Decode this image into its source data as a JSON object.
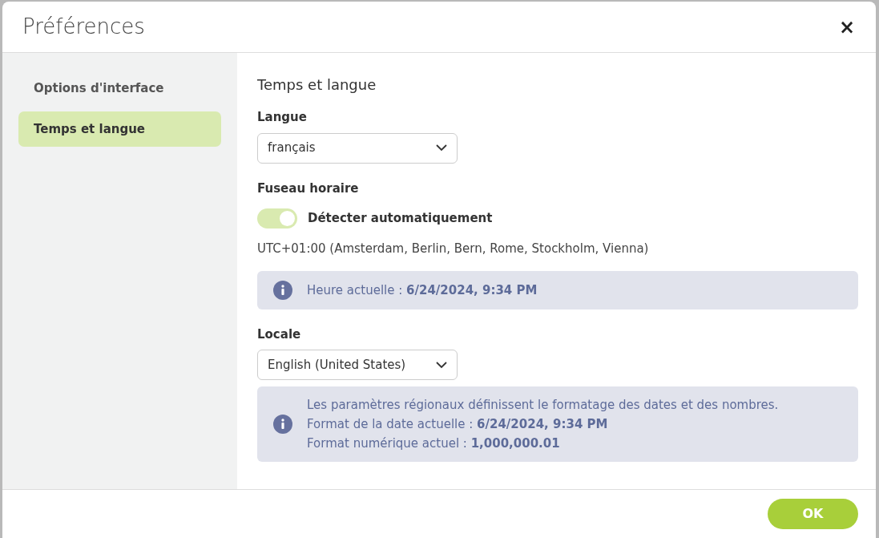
{
  "dialog": {
    "title": "Préférences",
    "close": "×"
  },
  "sidebar": {
    "items": [
      {
        "label": "Options d'interface",
        "selected": false
      },
      {
        "label": "Temps et langue",
        "selected": true
      }
    ]
  },
  "section": {
    "title": "Temps et langue",
    "language": {
      "label": "Langue",
      "value": "français"
    },
    "timezone": {
      "label": "Fuseau horaire",
      "toggle": {
        "label": "Détecter automatiquement",
        "on": true
      },
      "zone": "UTC+01:00 (Amsterdam, Berlin, Bern, Rome, Stockholm, Vienna)",
      "info": [
        "Heure actuelle : **6/24/2024, 9:34 PM**"
      ]
    },
    "locale": {
      "label": "Locale",
      "value": "English (United States)",
      "info": [
        "Les paramètres régionaux définissent le formatage des dates et des nombres.",
        "Format de la date actuelle : **6/24/2024, 9:34 PM**",
        "Format numérique actuel : **1,000,000.01**"
      ]
    }
  },
  "footer": {
    "buttons": [
      "OK"
    ]
  }
}
